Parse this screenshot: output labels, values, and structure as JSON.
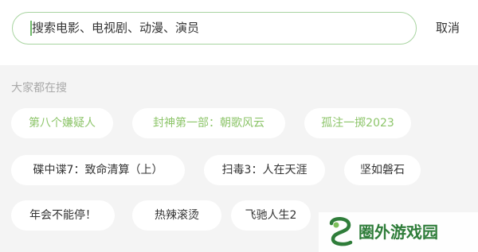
{
  "search": {
    "placeholder": "搜索电影、电视剧、动漫、演员",
    "cancel_label": "取消"
  },
  "section": {
    "title": "大家都在搜"
  },
  "tags": [
    {
      "label": "第八个嫌疑人",
      "hot": true
    },
    {
      "label": "封神第一部：朝歌风云",
      "hot": true
    },
    {
      "label": "孤注一掷2023",
      "hot": true
    },
    {
      "label": "碟中谍7：致命清算（上）",
      "hot": false
    },
    {
      "label": "扫毒3：人在天涯",
      "hot": false
    },
    {
      "label": "坚如磐石",
      "hot": false
    },
    {
      "label": "年会不能停！",
      "hot": false
    },
    {
      "label": "热辣滚烫",
      "hot": false
    },
    {
      "label": "飞驰人生2",
      "hot": false
    }
  ],
  "watermark": {
    "text": "圈外游戏园"
  },
  "colors": {
    "accent": "#8dc56a",
    "search_border": "#a8d4a0",
    "watermark_green": "#2f7d3a"
  }
}
